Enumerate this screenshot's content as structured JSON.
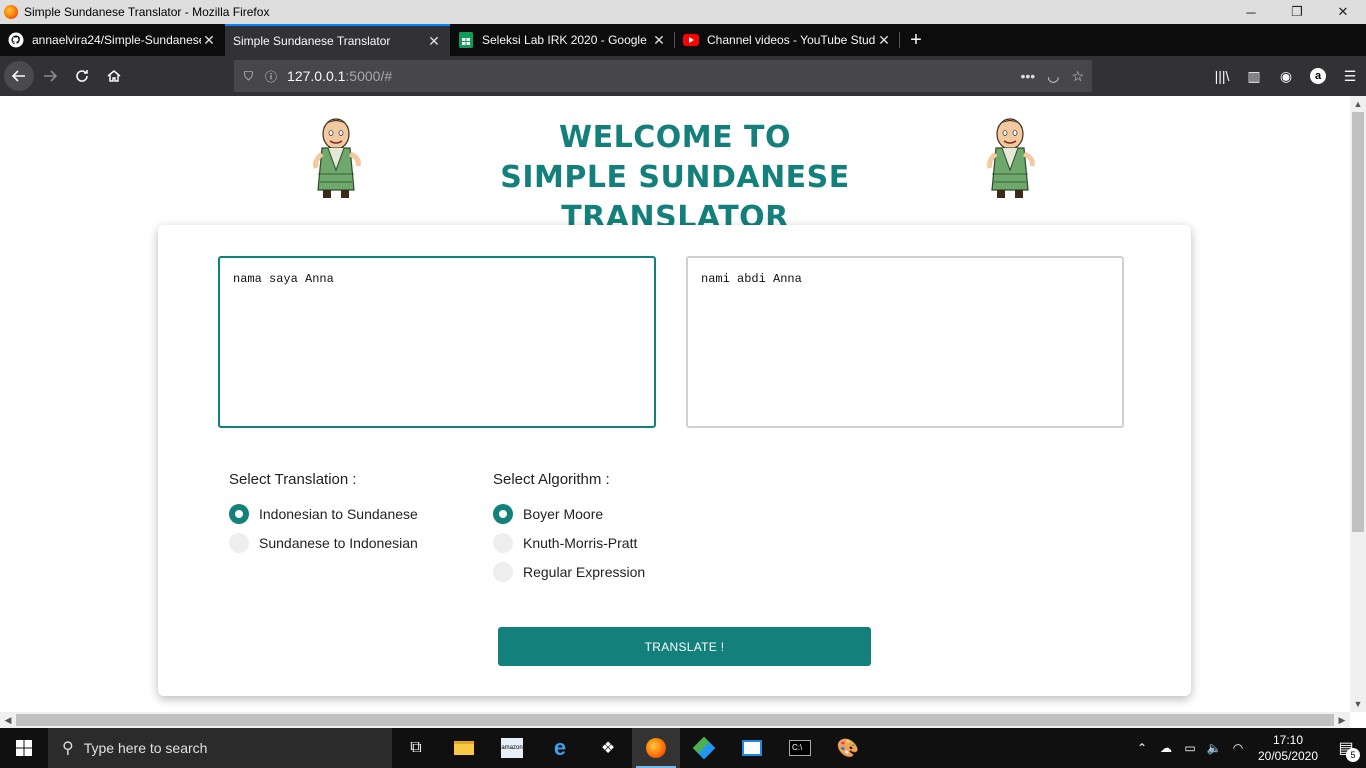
{
  "window": {
    "title": "Simple Sundanese Translator - Mozilla Firefox",
    "controls": {
      "minimize": "─",
      "restore": "❐",
      "close": "✕"
    }
  },
  "tabs": [
    {
      "title": "annaelvira24/Simple-Sundanese",
      "icon": "github-icon"
    },
    {
      "title": "Simple Sundanese Translator",
      "icon": "none"
    },
    {
      "title": "Seleksi Lab IRK 2020 - Google Sheets",
      "icon": "google-sheets-icon"
    },
    {
      "title": "Channel videos - YouTube Studio",
      "icon": "youtube-icon"
    }
  ],
  "newtab_label": "+",
  "nav": {
    "url_host": "127.0.0.1",
    "url_path": ":5000/#"
  },
  "page": {
    "welcome_line1": "WELCOME TO",
    "welcome_line2": "SIMPLE SUNDANESE TRANSLATOR",
    "input_text": "nama saya Anna",
    "output_text": "nami abdi Anna",
    "translation_label": "Select Translation :",
    "translation_options": [
      {
        "label": "Indonesian to Sundanese",
        "checked": true
      },
      {
        "label": "Sundanese to Indonesian",
        "checked": false
      }
    ],
    "algorithm_label": "Select Algorithm :",
    "algorithm_options": [
      {
        "label": "Boyer Moore",
        "checked": true
      },
      {
        "label": "Knuth-Morris-Pratt",
        "checked": false
      },
      {
        "label": "Regular Expression",
        "checked": false
      }
    ],
    "translate_button": "TRANSLATE !",
    "accent_color": "#14807c"
  },
  "taskbar": {
    "search_placeholder": "Type here to search",
    "time": "17:10",
    "date": "20/05/2020",
    "notification_count": "5"
  }
}
